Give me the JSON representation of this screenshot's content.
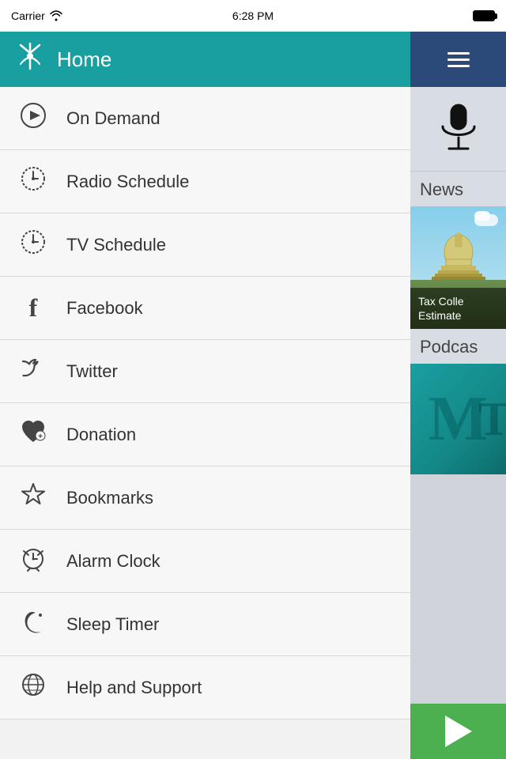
{
  "statusBar": {
    "carrier": "Carrier",
    "time": "6:28 PM"
  },
  "drawer": {
    "header": {
      "title": "Home",
      "iconName": "antenna-icon"
    },
    "items": [
      {
        "id": "on-demand",
        "label": "On Demand",
        "icon": "▶",
        "iconName": "play-icon"
      },
      {
        "id": "radio-schedule",
        "label": "Radio Schedule",
        "icon": "🕐",
        "iconName": "clock-icon"
      },
      {
        "id": "tv-schedule",
        "label": "TV Schedule",
        "icon": "🕐",
        "iconName": "clock-icon"
      },
      {
        "id": "facebook",
        "label": "Facebook",
        "icon": "f",
        "iconName": "facebook-icon"
      },
      {
        "id": "twitter",
        "label": "Twitter",
        "icon": "t",
        "iconName": "twitter-icon"
      },
      {
        "id": "donation",
        "label": "Donation",
        "icon": "♥",
        "iconName": "heart-icon"
      },
      {
        "id": "bookmarks",
        "label": "Bookmarks",
        "icon": "☆",
        "iconName": "star-icon"
      },
      {
        "id": "alarm-clock",
        "label": "Alarm Clock",
        "icon": "⏰",
        "iconName": "alarm-icon"
      },
      {
        "id": "sleep-timer",
        "label": "Sleep Timer",
        "icon": "☽",
        "iconName": "moon-icon"
      },
      {
        "id": "help-support",
        "label": "Help and Support",
        "icon": "🌐",
        "iconName": "globe-icon"
      }
    ]
  },
  "rightPanel": {
    "news": {
      "sectionLabel": "News",
      "card": {
        "text": "Tax Colle\nEstimate"
      }
    },
    "podcast": {
      "sectionLabel": "Podcas",
      "card": {
        "letter": "M"
      }
    },
    "playBar": {
      "label": "Play"
    }
  }
}
